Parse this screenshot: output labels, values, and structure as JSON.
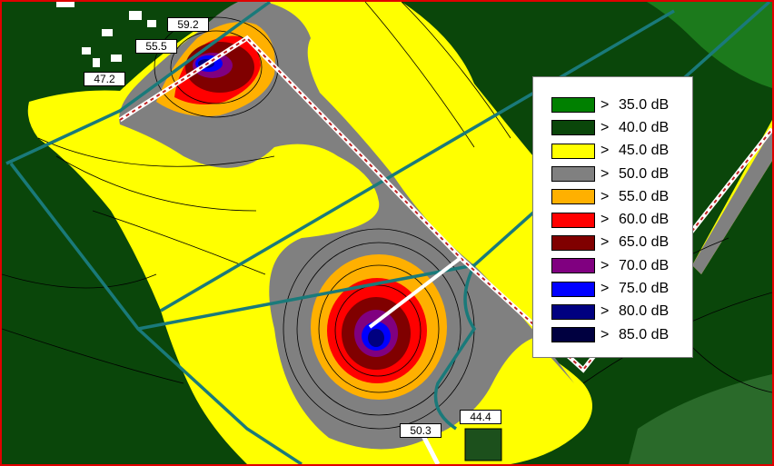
{
  "legend": {
    "entries": [
      {
        "gt": ">",
        "label": "35.0 dB",
        "color": "#008000"
      },
      {
        "gt": ">",
        "label": "40.0 dB",
        "color": "#0a460a"
      },
      {
        "gt": ">",
        "label": "45.0 dB",
        "color": "#ffff00"
      },
      {
        "gt": ">",
        "label": "50.0 dB",
        "color": "#808080"
      },
      {
        "gt": ">",
        "label": "55.0 dB",
        "color": "#ffb000"
      },
      {
        "gt": ">",
        "label": "60.0 dB",
        "color": "#ff0000"
      },
      {
        "gt": ">",
        "label": "65.0 dB",
        "color": "#800000"
      },
      {
        "gt": ">",
        "label": "70.0 dB",
        "color": "#800080"
      },
      {
        "gt": ">",
        "label": "75.0 dB",
        "color": "#0000ff"
      },
      {
        "gt": ">",
        "label": "80.0 dB",
        "color": "#000080"
      },
      {
        "gt": ">",
        "label": "85.0 dB",
        "color": "#000040"
      }
    ]
  },
  "receiver_labels": [
    "59.2",
    "55.5",
    "47.2",
    "50.3",
    "44.4"
  ],
  "colors": {
    "frame_border": "#e00000",
    "boundary_line": "#1a7a7a",
    "road": "#ffffff"
  }
}
